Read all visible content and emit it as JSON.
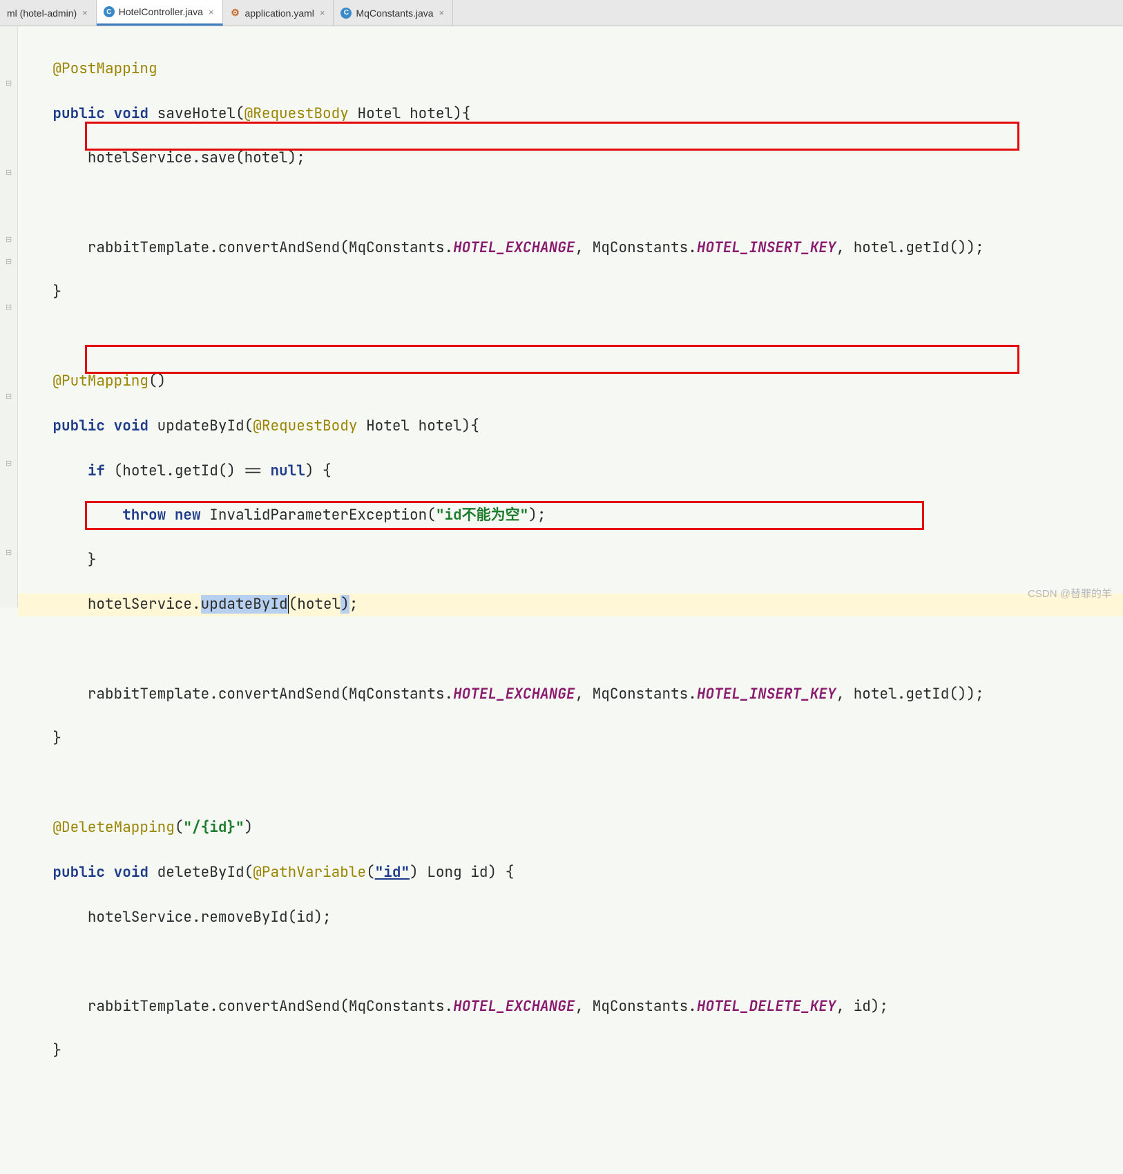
{
  "tabs": [
    {
      "label": "ml (hotel-admin)",
      "icon": "",
      "active": false
    },
    {
      "label": "HotelController.java",
      "icon": "C",
      "iconClass": "c-java",
      "active": true
    },
    {
      "label": "application.yaml",
      "icon": "⚙",
      "iconClass": "c-yaml",
      "active": false
    },
    {
      "label": "MqConstants.java",
      "icon": "C",
      "iconClass": "c-java",
      "active": false
    }
  ],
  "code": {
    "ann_post": "@PostMapping",
    "ann_put": "@PutMapping",
    "ann_delete": "@DeleteMapping",
    "ann_reqbody": "@RequestBody",
    "ann_pathvar": "@PathVariable",
    "kw_public": "public",
    "kw_void": "void",
    "kw_if": "if",
    "kw_throw": "throw",
    "kw_new": "new",
    "kw_null": "null",
    "m_saveHotel": "saveHotel",
    "m_updateById": "updateById",
    "m_deleteById": "deleteById",
    "t_Hotel": "Hotel",
    "t_Long": "Long",
    "t_Invalid": "InvalidParameterException",
    "p_hotel": "hotel",
    "p_id": "id",
    "svc": "hotelService",
    "m_save": "save",
    "m_upd": "updateById",
    "m_remove": "removeById",
    "rt": "rabbitTemplate",
    "m_cas": "convertAndSend",
    "mq": "MqConstants",
    "c_exchange": "HOTEL_EXCHANGE",
    "c_insert": "HOTEL_INSERT_KEY",
    "c_delete": "HOTEL_DELETE_KEY",
    "m_getId": "getId",
    "s_path": "\"/{id}\"",
    "s_id": "\"id\"",
    "s_err": "\"id不能为空\""
  },
  "watermark": "CSDN @替罪的羊"
}
